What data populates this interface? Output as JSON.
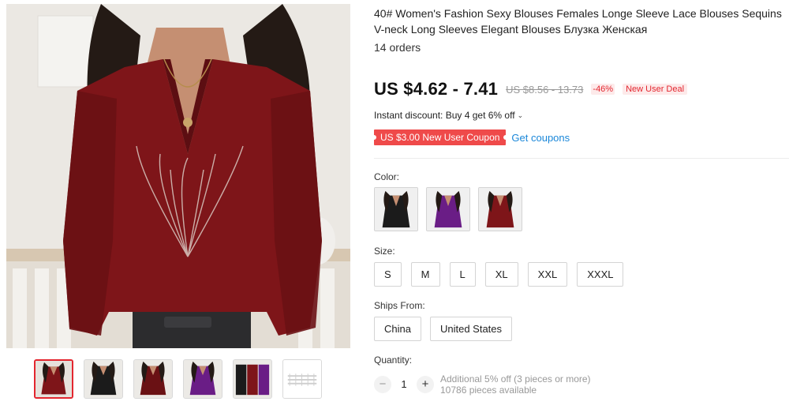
{
  "product": {
    "title": "40# Women's Fashion Sexy Blouses Females Longe Sleeve Lace Blouses Sequins V-neck Long Sleeves Elegant Blouses Блузка Женская",
    "orders": "14 orders"
  },
  "price": {
    "current": "US $4.62 - 7.41",
    "original": "US $8.56 - 13.73",
    "discount": "-46%",
    "deal_badge": "New User Deal"
  },
  "instant_discount": "Instant discount: Buy 4 get 6% off",
  "coupon": {
    "label": "US $3.00 New User Coupon",
    "get_link": "Get coupons"
  },
  "color": {
    "label": "Color:",
    "options": [
      "black",
      "purple",
      "wine red"
    ]
  },
  "size": {
    "label": "Size:",
    "options": [
      "S",
      "M",
      "L",
      "XL",
      "XXL",
      "XXXL"
    ]
  },
  "ships_from": {
    "label": "Ships From:",
    "options": [
      "China",
      "United States"
    ]
  },
  "quantity": {
    "label": "Quantity:",
    "value": "1",
    "minus": "−",
    "plus": "+",
    "promo": "Additional 5% off (3 pieces or more)",
    "available": "10786 pieces available"
  },
  "gallery": {
    "thumbnail_count": 6,
    "active_index": 0
  },
  "colors": {
    "price_red": "#e3262f",
    "coupon_bg": "#ef4a4a",
    "link_blue": "#1a87d9",
    "wine": "#8c1a1e",
    "purple": "#6a1d86",
    "black": "#1b1b1b"
  }
}
